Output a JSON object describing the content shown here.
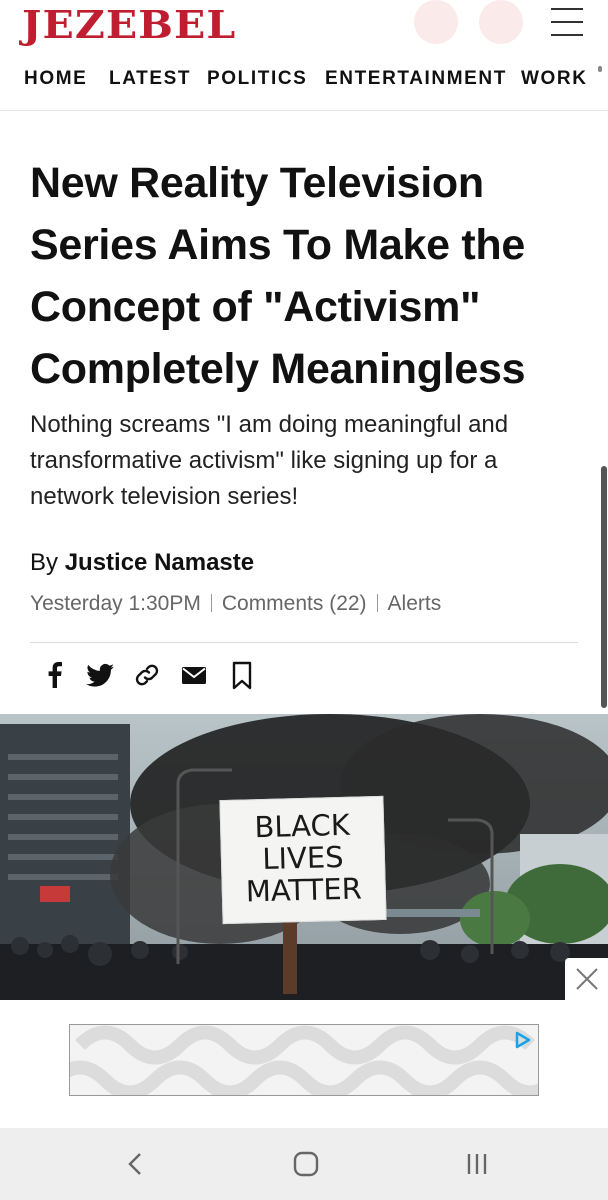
{
  "header": {
    "logo": "JEZEBEL",
    "nav": [
      "HOME",
      "LATEST",
      "POLITICS",
      "ENTERTAINMENT",
      "WORK"
    ]
  },
  "article": {
    "headline_lines": [
      "New Reality Television",
      "Series Aims To Make the",
      "Concept of \"Activism\"",
      "Completely Meaningless"
    ],
    "subhead": "Nothing screams \"I am doing meaningful and transformative activism\" like signing up for a network television series!",
    "byline_prefix": "By",
    "author": "Justice Namaste",
    "timestamp": "Yesterday 1:30PM",
    "comments": "Comments (22)",
    "alerts": "Alerts",
    "share_icons": [
      "facebook-icon",
      "twitter-icon",
      "link-icon",
      "mail-icon",
      "bookmark-icon"
    ]
  },
  "hero": {
    "sign_lines": [
      "BLACK",
      "LIVES",
      "MATTER"
    ]
  },
  "colors": {
    "brand": "#c01d30",
    "ad_icon": "#1aa3e8"
  }
}
